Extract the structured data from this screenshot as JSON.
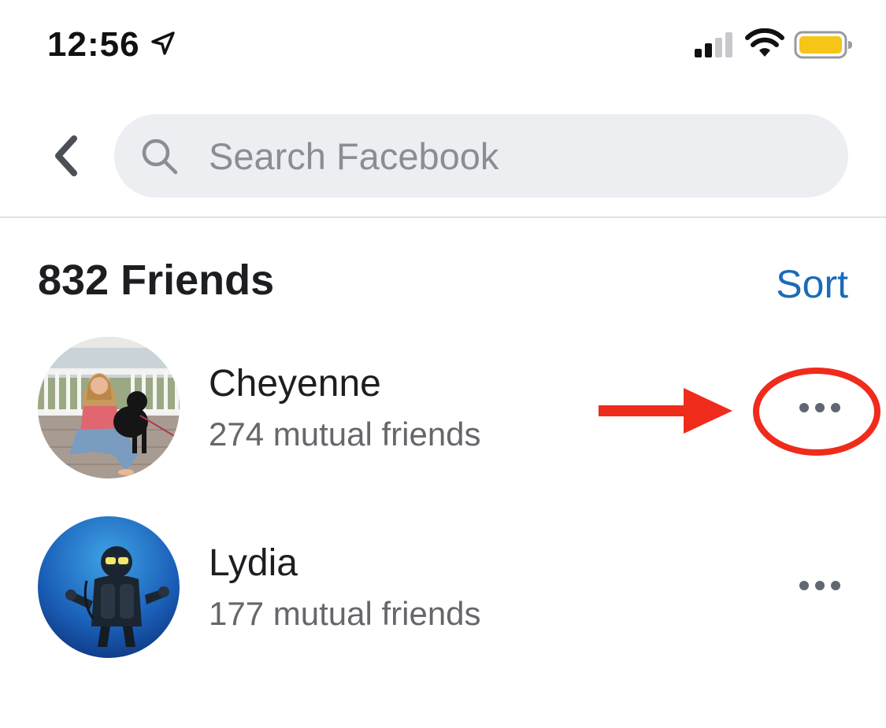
{
  "status_bar": {
    "time": "12:56",
    "icons": [
      "location-arrow-icon",
      "cellular-signal-icon",
      "wifi-icon",
      "battery-icon"
    ],
    "battery_color": "#f5c518"
  },
  "header": {
    "back_icon": "chevron-left-icon",
    "search": {
      "icon": "search-icon",
      "placeholder": "Search Facebook",
      "value": ""
    }
  },
  "friends_section": {
    "title": "832 Friends",
    "sort_label": "Sort",
    "accent_color": "#1a6bb8"
  },
  "friends": [
    {
      "name": "Cheyenne",
      "mutual": "274 mutual friends",
      "more_icon": "more-options-icon"
    },
    {
      "name": "Lydia",
      "mutual": "177 mutual friends",
      "more_icon": "more-options-icon"
    }
  ],
  "annotation": {
    "color": "#ef2b1c",
    "shapes": [
      "arrow-right-icon",
      "highlight-ellipse"
    ]
  }
}
